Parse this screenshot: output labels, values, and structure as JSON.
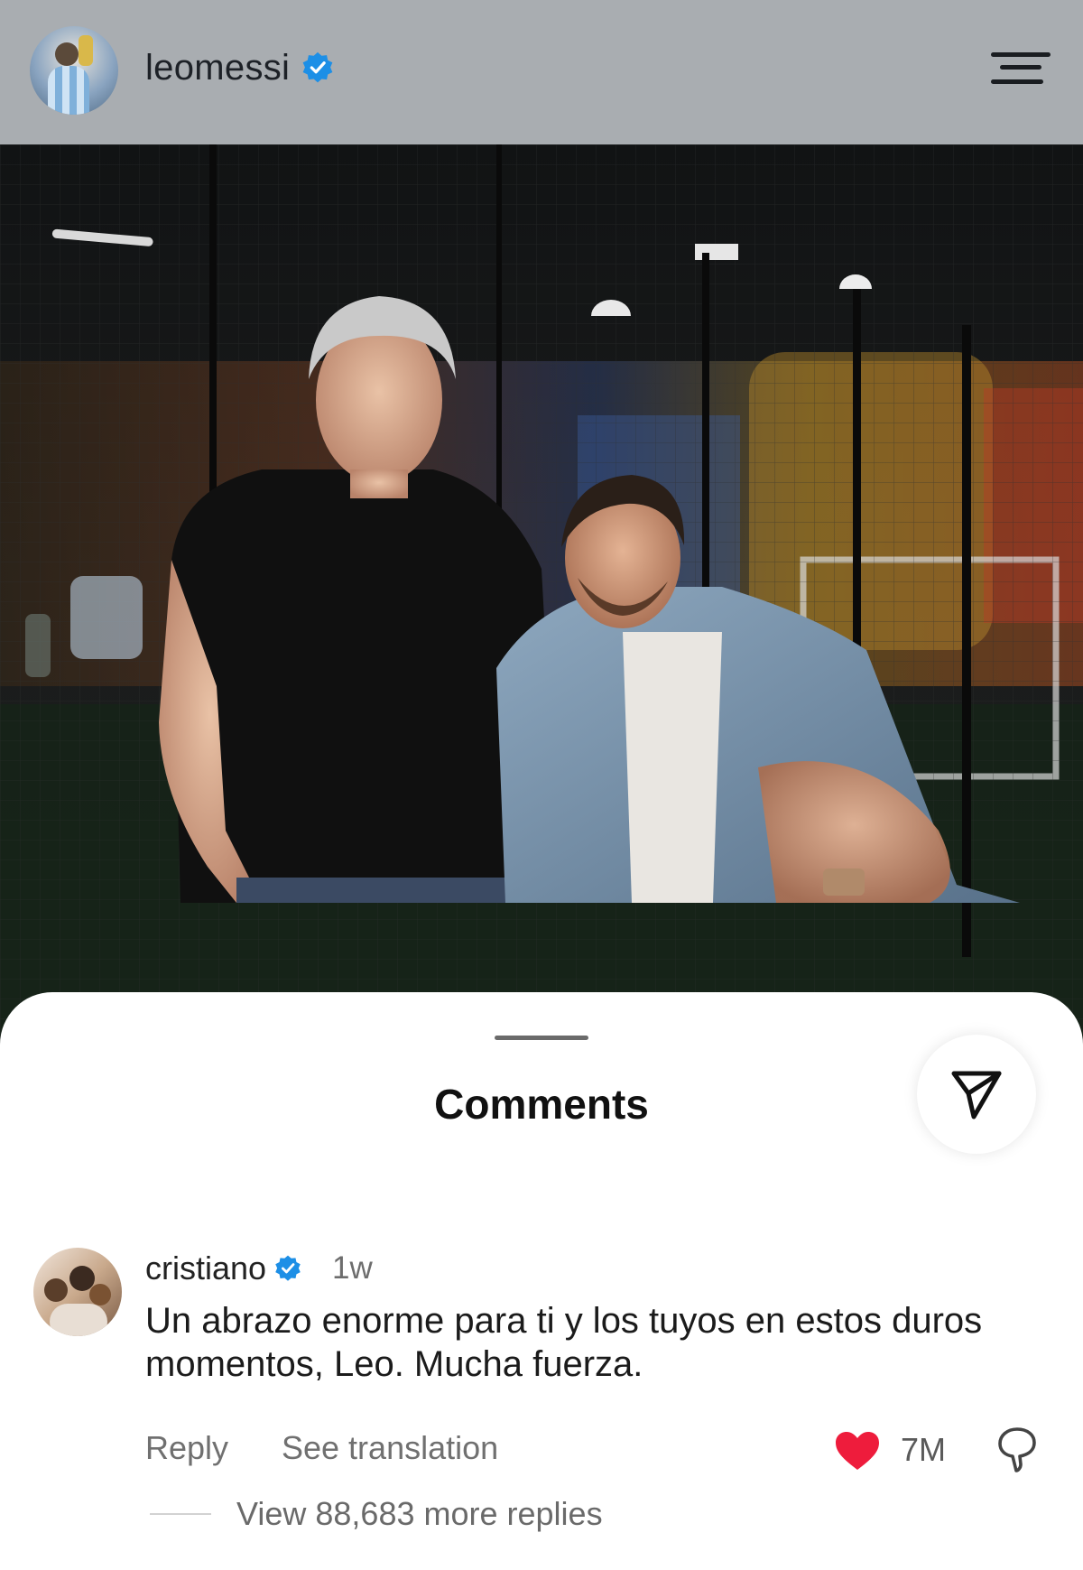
{
  "header": {
    "username": "leomessi",
    "verified": true
  },
  "post": {
    "image_alt": "Two men posing in an indoor football facility"
  },
  "comments_sheet": {
    "title": "Comments",
    "comment": {
      "username": "cristiano",
      "verified": true,
      "time": "1w",
      "text": "Un abrazo enorme para ti y los tuyos en estos duros momentos, Leo. Mucha fuerza.",
      "reply_label": "Reply",
      "translate_label": "See translation",
      "like_count": "7M",
      "view_replies_label": "View 88,683 more replies"
    }
  },
  "colors": {
    "header_bg": "#a9adb1",
    "verified_blue": "#1d8fe6",
    "like_red": "#ee1c3c"
  },
  "icons": {
    "menu": "menu-icon",
    "verified": "verified-badge-icon",
    "share": "send-icon",
    "like": "heart-icon",
    "dislike": "thumbs-down-icon"
  }
}
